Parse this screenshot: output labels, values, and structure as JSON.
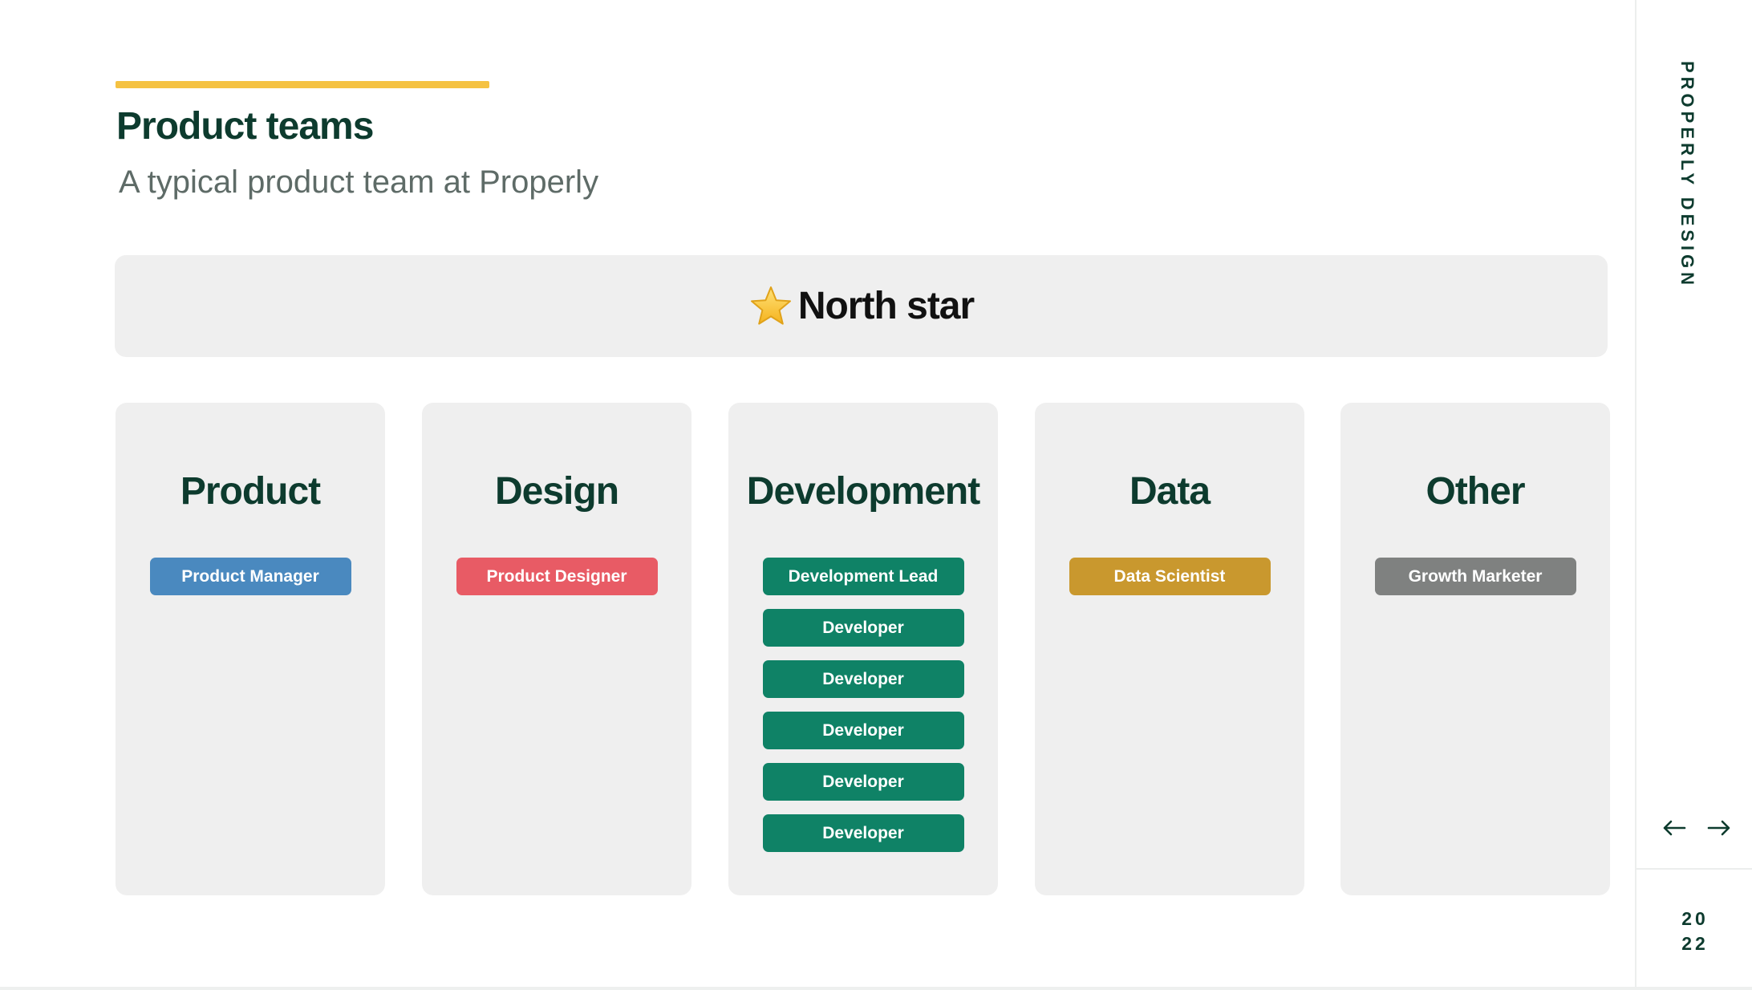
{
  "header": {
    "title": "Product teams",
    "subtitle": "A typical product team at Properly"
  },
  "north_star": {
    "icon": "star-icon",
    "label": "North star"
  },
  "columns": [
    {
      "title": "Product",
      "roles": [
        {
          "label": "Product Manager",
          "color": "#4a89bf"
        }
      ]
    },
    {
      "title": "Design",
      "roles": [
        {
          "label": "Product Designer",
          "color": "#e85b65"
        }
      ]
    },
    {
      "title": "Development",
      "roles": [
        {
          "label": "Development Lead",
          "color": "#0f8266"
        },
        {
          "label": "Developer",
          "color": "#0f8266"
        },
        {
          "label": "Developer",
          "color": "#0f8266"
        },
        {
          "label": "Developer",
          "color": "#0f8266"
        },
        {
          "label": "Developer",
          "color": "#0f8266"
        },
        {
          "label": "Developer",
          "color": "#0f8266"
        }
      ]
    },
    {
      "title": "Data",
      "roles": [
        {
          "label": "Data Scientist",
          "color": "#c9982e"
        }
      ]
    },
    {
      "title": "Other",
      "roles": [
        {
          "label": "Growth Marketer",
          "color": "#7f8180"
        }
      ]
    }
  ],
  "sidebar": {
    "brand": "PROPERLY DESIGN",
    "prev_icon": "arrow-left-icon",
    "next_icon": "arrow-right-icon",
    "year_top": "20",
    "year_bottom": "22"
  },
  "colors": {
    "accent": "#f5c242",
    "heading": "#0d3b2e",
    "panel": "#efefef"
  }
}
